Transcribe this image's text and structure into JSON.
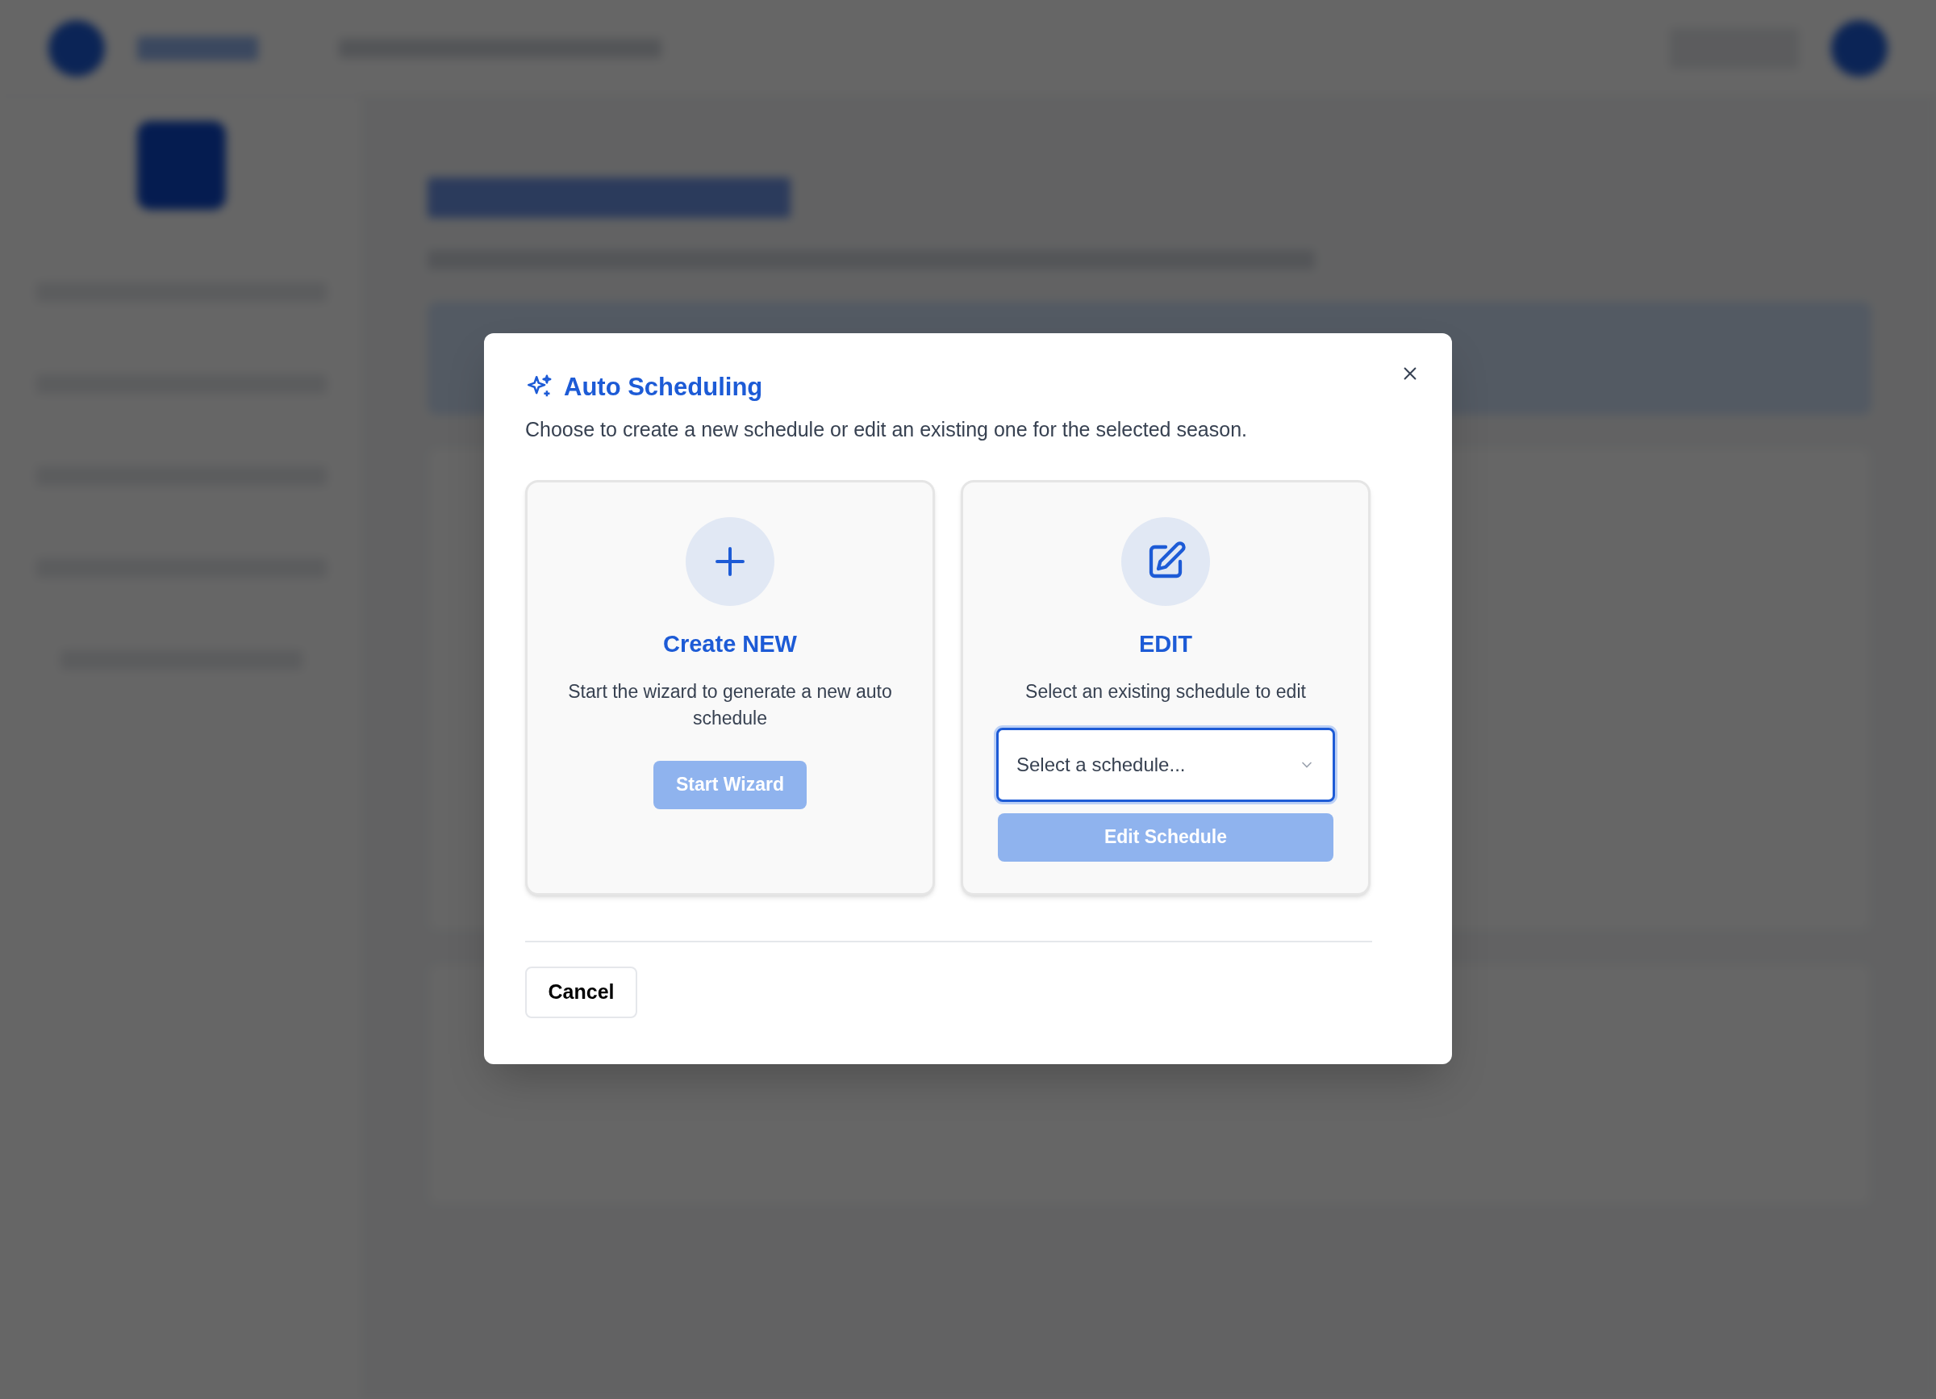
{
  "dialog": {
    "title": "Auto Scheduling",
    "description": "Choose to create a new schedule or edit an existing one for the selected season.",
    "options": [
      {
        "kind": "create",
        "heading": "Create NEW",
        "text": "Start the wizard to generate a new auto schedule",
        "button": "Start Wizard",
        "disabled": true
      },
      {
        "kind": "edit",
        "heading": "EDIT",
        "text": "Select an existing schedule to edit",
        "select": {
          "placeholder": "Select a schedule...",
          "focused": true
        },
        "button": "Edit Schedule",
        "disabled": true
      }
    ],
    "cancel": "Cancel"
  }
}
